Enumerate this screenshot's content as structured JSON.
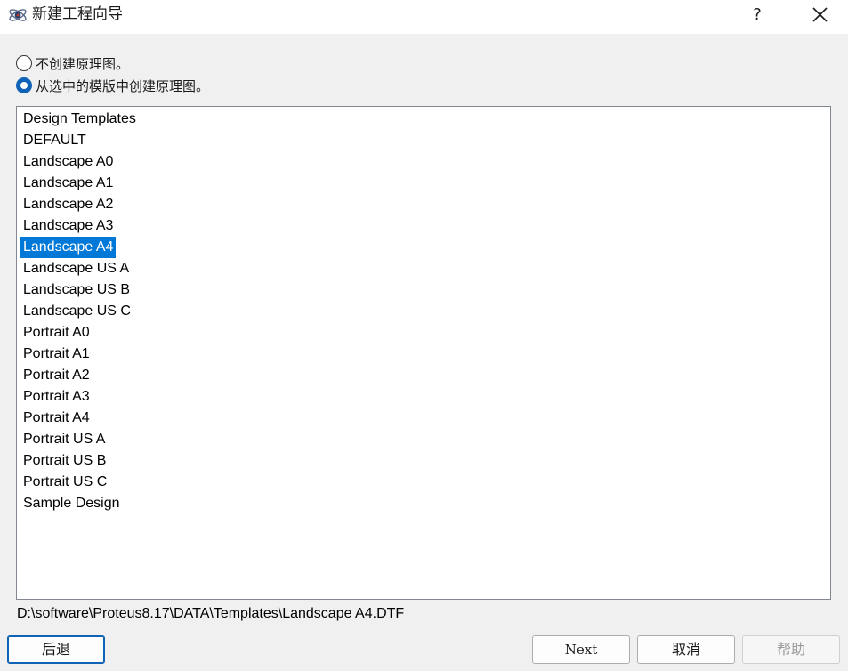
{
  "window": {
    "title": "新建工程向导",
    "help_label": "?",
    "icon": "proteus-atom-icon"
  },
  "options": [
    {
      "label": "不创建原理图。",
      "checked": false
    },
    {
      "label": "从选中的模版中创建原理图。",
      "checked": true
    }
  ],
  "templates": {
    "items": [
      "Design Templates",
      "DEFAULT",
      "Landscape A0",
      "Landscape A1",
      "Landscape A2",
      "Landscape A3",
      "Landscape A4",
      "Landscape US A",
      "Landscape US B",
      "Landscape US C",
      "Portrait A0",
      "Portrait A1",
      "Portrait A2",
      "Portrait A3",
      "Portrait A4",
      "Portrait US A",
      "Portrait US B",
      "Portrait US C",
      "Sample Design"
    ],
    "selected": "Landscape A4"
  },
  "selected_path": "D:\\software\\Proteus8.17\\DATA\\Templates\\Landscape A4.DTF",
  "buttons": {
    "back": "后退",
    "next": "Next",
    "cancel": "取消",
    "help": "帮助"
  },
  "colors": {
    "accent": "#0078d7",
    "radio_checked": "#0f62b6"
  }
}
